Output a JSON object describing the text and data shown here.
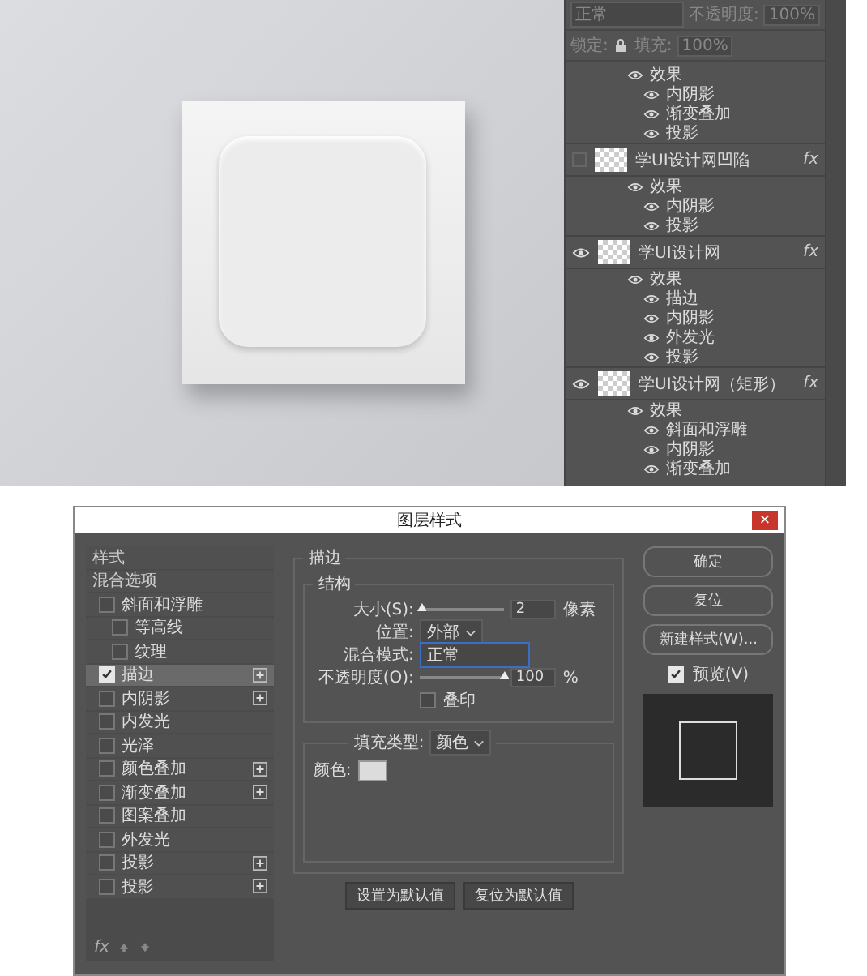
{
  "layers_panel": {
    "blend_mode": "正常",
    "opacity_label": "不透明度:",
    "opacity": "100%",
    "lock_label": "锁定:",
    "fill_label": "填充:",
    "fill": "100%",
    "layers": [
      {
        "effects_label": "效果",
        "effects": [
          "内阴影",
          "渐变叠加",
          "投影"
        ]
      },
      {
        "name": "学UI设计网凹陷",
        "visible": false,
        "fx": "fx",
        "effects_label": "效果",
        "effects": [
          "内阴影",
          "投影"
        ]
      },
      {
        "name": "学UI设计网",
        "visible": true,
        "fx": "fx",
        "effects_label": "效果",
        "effects": [
          "描边",
          "内阴影",
          "外发光",
          "投影"
        ]
      },
      {
        "name": "学UI设计网（矩形）",
        "visible": true,
        "fx": "fx",
        "effects_label": "效果",
        "effects": [
          "斜面和浮雕",
          "内阴影",
          "渐变叠加"
        ]
      }
    ]
  },
  "dialog": {
    "title": "图层样式",
    "close": "×",
    "style_list": [
      {
        "kind": "header",
        "label": "样式"
      },
      {
        "kind": "header",
        "label": "混合选项"
      },
      {
        "kind": "checkbox",
        "label": "斜面和浮雕",
        "checked": false,
        "selected": false,
        "plus": false,
        "children": [
          {
            "kind": "checkbox",
            "label": "等高线",
            "checked": false,
            "selected": false,
            "plus": false
          },
          {
            "kind": "checkbox",
            "label": "纹理",
            "checked": false,
            "selected": false,
            "plus": false
          }
        ]
      },
      {
        "kind": "checkbox",
        "label": "描边",
        "checked": true,
        "selected": true,
        "plus": true
      },
      {
        "kind": "checkbox",
        "label": "内阴影",
        "checked": false,
        "selected": false,
        "plus": true
      },
      {
        "kind": "checkbox",
        "label": "内发光",
        "checked": false,
        "selected": false,
        "plus": false
      },
      {
        "kind": "checkbox",
        "label": "光泽",
        "checked": false,
        "selected": false,
        "plus": false
      },
      {
        "kind": "checkbox",
        "label": "颜色叠加",
        "checked": false,
        "selected": false,
        "plus": true
      },
      {
        "kind": "checkbox",
        "label": "渐变叠加",
        "checked": false,
        "selected": false,
        "plus": true
      },
      {
        "kind": "checkbox",
        "label": "图案叠加",
        "checked": false,
        "selected": false,
        "plus": false
      },
      {
        "kind": "checkbox",
        "label": "外发光",
        "checked": false,
        "selected": false,
        "plus": false
      },
      {
        "kind": "checkbox",
        "label": "投影",
        "checked": false,
        "selected": false,
        "plus": true
      },
      {
        "kind": "checkbox",
        "label": "投影",
        "checked": false,
        "selected": false,
        "plus": true
      }
    ],
    "list_footer": "fx",
    "stroke": {
      "title": "描边",
      "structure_title": "结构",
      "size_label": "大小(S):",
      "size_slider": {
        "level": 0.02
      },
      "size": "2",
      "size_unit": "像素",
      "position_label": "位置:",
      "position": "外部",
      "blend_label": "混合模式:",
      "blend": "正常",
      "opacity_label": "不透明度(O):",
      "opacity_slider": {
        "level": 1
      },
      "opacity": "100",
      "opacity_unit": "%",
      "overprint_label": "叠印",
      "overprint": false,
      "fill_type_label": "填充类型:",
      "fill_type": "颜色",
      "color_label": "颜色:",
      "color": "#dcdcdc"
    },
    "default_buttons": [
      "设置为默认值",
      "复位为默认值"
    ],
    "buttons": [
      "确定",
      "复位",
      "新建样式(W)..."
    ],
    "preview_label": "预览(V)",
    "preview": true
  }
}
